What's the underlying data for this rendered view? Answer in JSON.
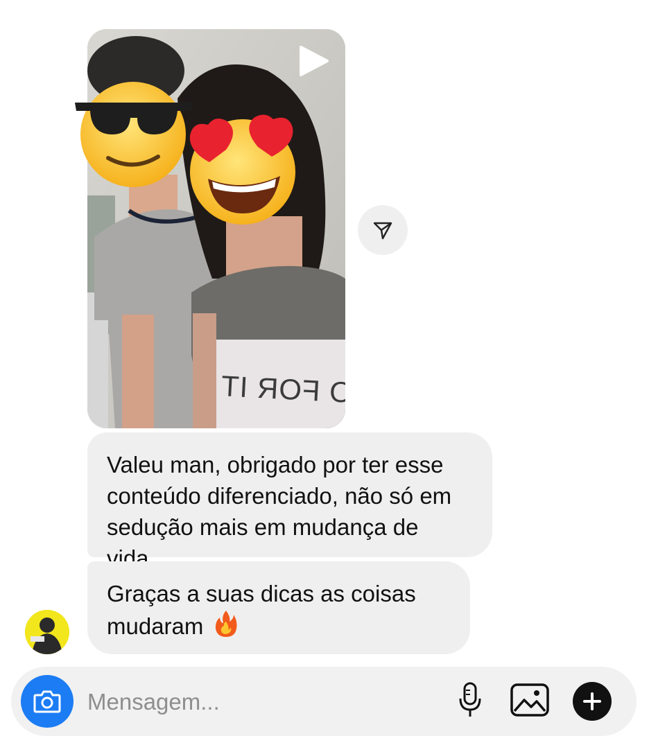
{
  "messages": [
    {
      "type": "video",
      "shirt_text": "O FOR IT"
    },
    {
      "type": "text",
      "text": "Valeu man, obrigado por ter esse conteúdo diferenciado, não só em sedução mais em mudança de vida."
    },
    {
      "type": "text",
      "text": "Graças a suas dicas as coisas mudaram",
      "emoji": "fire-icon"
    }
  ],
  "composer": {
    "placeholder": "Mensagem..."
  },
  "icons": {
    "camera": "camera-icon",
    "mic": "microphone-icon",
    "gallery": "image-gallery-icon",
    "plus": "plus-icon",
    "share": "send-share-icon",
    "play": "play-icon"
  },
  "colors": {
    "bubble_bg": "#efefef",
    "camera_button": "#1c7cf4",
    "composer_bg": "#f1f1f1",
    "avatar_bg": "#f2e61c"
  }
}
